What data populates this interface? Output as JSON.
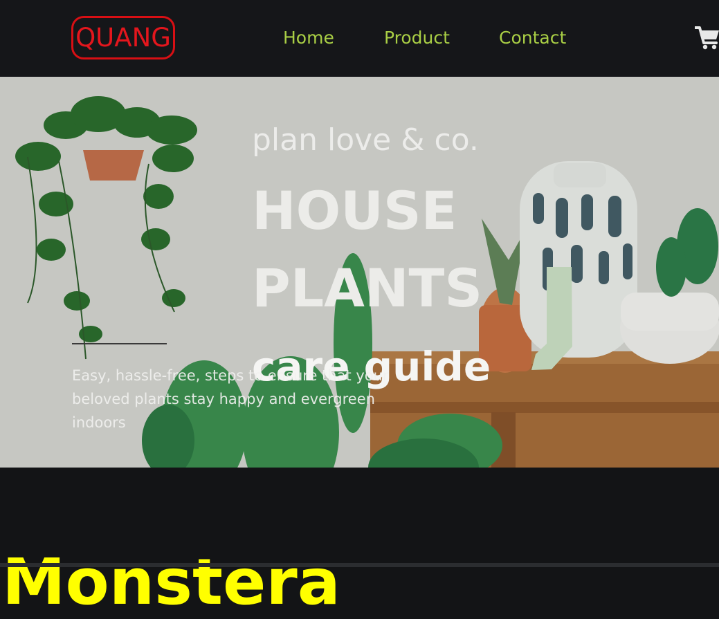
{
  "header": {
    "logo": "QUANG",
    "nav": [
      {
        "label": "Home"
      },
      {
        "label": "Product"
      },
      {
        "label": "Contact"
      }
    ],
    "cart_icon": "shopping-cart-icon"
  },
  "hero": {
    "brand": "plan love & co.",
    "title_line1": "HOUSE",
    "title_line2": "PLANTS",
    "subtitle": "care guide",
    "intro": "Easy, hassle-free, steps to ensure that your beloved plants stay happy and evergreen indoors",
    "image": "house-plants-photo"
  },
  "section": {
    "title": "Monstera"
  },
  "colors": {
    "header_bg": "#151619",
    "logo_red": "#e4161d",
    "nav_green": "#a9ce45",
    "section_title_yellow": "#ffff00"
  }
}
